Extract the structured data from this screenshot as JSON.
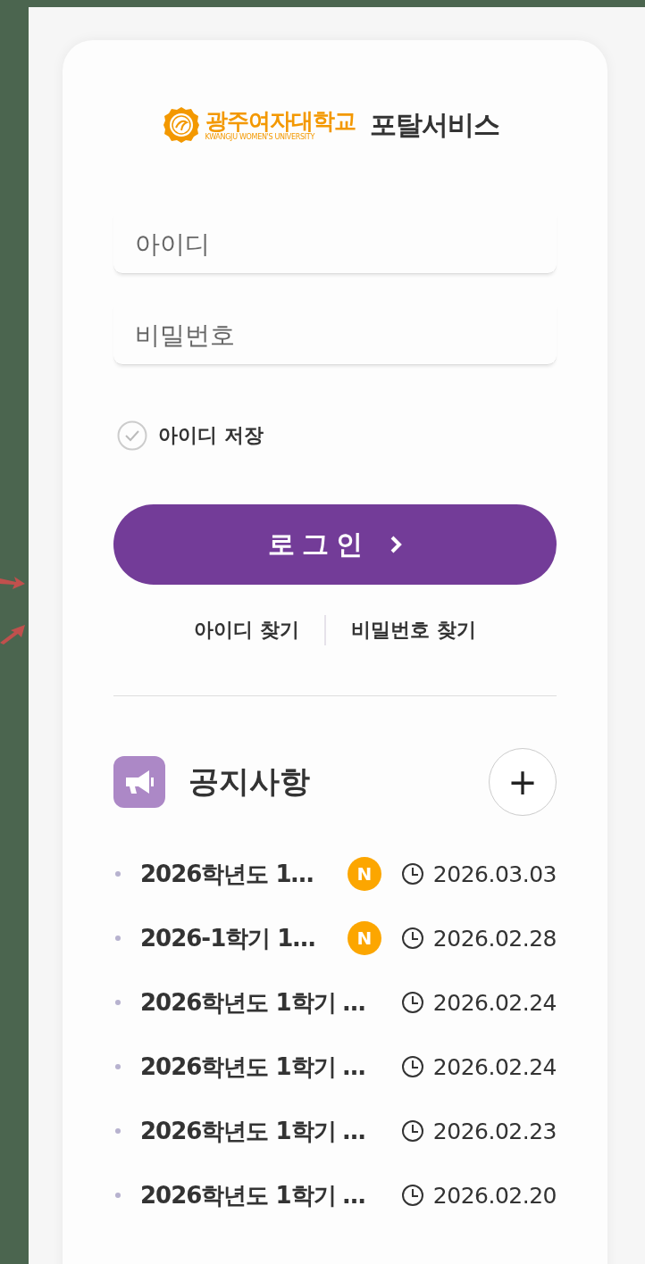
{
  "logo": {
    "name": "광주여자대학교",
    "subtitle": "KWANGJU WOMEN'S UNIVERSITY"
  },
  "portal_title": "포탈서비스",
  "login": {
    "id_field": {
      "placeholder": "아이디"
    },
    "password_field": {
      "placeholder": "비밀번호"
    },
    "remember_id": {
      "label": "아이디 저장",
      "checked": false
    },
    "button": "로그인",
    "links": [
      "아이디 찾기",
      "비밀번호 찾기"
    ]
  },
  "notices": {
    "title": "공지사항",
    "more_button": "+",
    "items": [
      {
        "title": "2026학년도 1…",
        "badge": "N",
        "date": "2026.03.03"
      },
      {
        "title": "2026-1학기 1…",
        "badge": "N",
        "date": "2026.02.28"
      },
      {
        "title": "2026학년도 1학기 …",
        "date": "2026.02.24"
      },
      {
        "title": "2026학년도 1학기 …",
        "date": "2026.02.24"
      },
      {
        "title": "2026학년도 1학기 …",
        "date": "2026.02.23"
      },
      {
        "title": "2026학년도 1학기 …",
        "date": "2026.02.20"
      }
    ]
  }
}
